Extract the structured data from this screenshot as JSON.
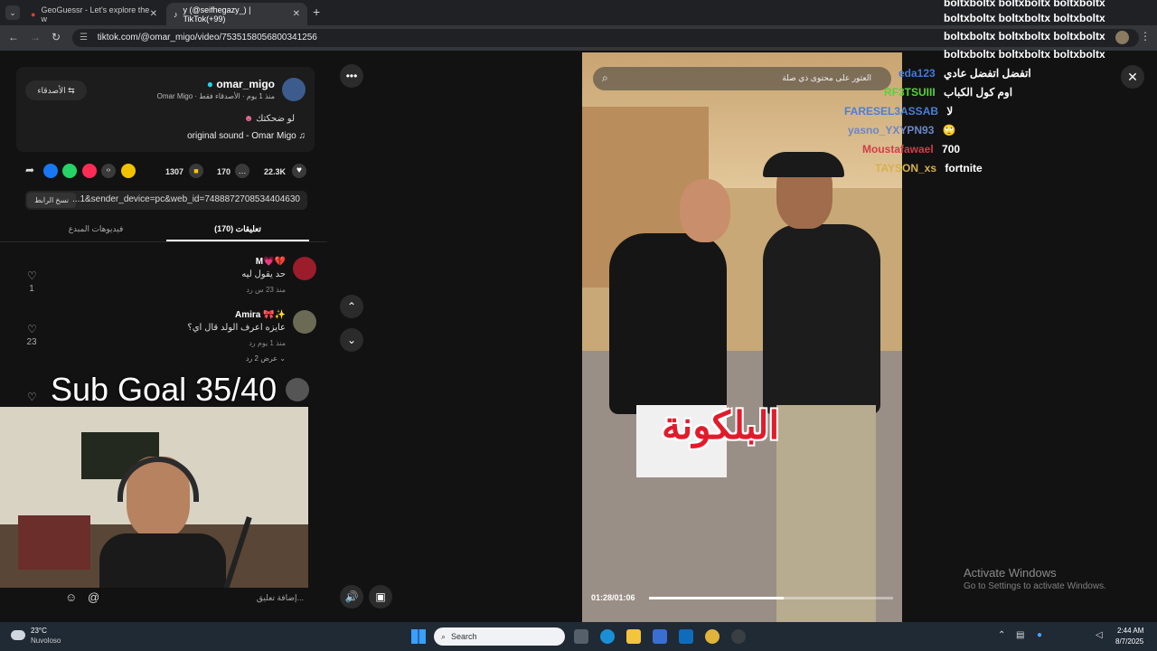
{
  "browser": {
    "tabs": [
      {
        "title": "GeoGuessr - Let's explore the w",
        "active": false
      },
      {
        "title": "y (@seifhegazy_) | TikTok(+99)",
        "active": true
      }
    ],
    "url": "tiktok.com/@omar_migo/video/7535158056800341256"
  },
  "post": {
    "username": "omar_migo",
    "meta": "Omar Migo · منذ 1 يوم · الأصدقاء فقط",
    "friends_button": "الأصدقاء",
    "caption": "لو ضحكتك",
    "sound": "original sound - Omar Migo",
    "counts": {
      "bookmarks": "1307",
      "comments": "170",
      "likes": "22.3K"
    },
    "link_text": "...1&sender_device=pc&web_id=7488872708534404630",
    "copy_link": "نسخ الرابط"
  },
  "tabs": {
    "comments": "(170) تعليقات",
    "creator_videos": "فيديوهات المبدع"
  },
  "comments": [
    {
      "name": "M💗💔",
      "text": "حد يقول ليه",
      "meta": "منذ 23 س   رد",
      "likes": "1"
    },
    {
      "name": "Amira 🎀✨",
      "text": "عايزه اعرف الولد قال اي؟",
      "meta": "منذ 1 يوم   رد",
      "likes": "23",
      "replies": "عرض 2 رد"
    }
  ],
  "overlay": {
    "sub_goal": "Sub Goal 35/40"
  },
  "comment_input": {
    "placeholder": "إضافة تعليق..."
  },
  "video": {
    "search_placeholder": "العثور على محتوى ذي صلة",
    "caption": "البلكونة",
    "time": "01:28/01:06",
    "progress": 0.55
  },
  "chat": {
    "spam": [
      "boltxboltx boltxboltx boltxboltx",
      "boltxboltx boltxboltx boltxboltx",
      "boltxboltx boltxboltx boltxboltx",
      "boltxboltx boltxboltx boltxboltx"
    ],
    "messages": [
      {
        "user": "eda123",
        "color": "#3f7be0",
        "text": "اتفضل اتفضل عادي"
      },
      {
        "user": "RF3TSUIII",
        "color": "#5ad13d",
        "text": "اوم كول الكباب"
      },
      {
        "user": "FARESEL3ASSAB",
        "color": "#4a7fd6",
        "text": "لا"
      },
      {
        "user": "yasno_YXYPN93",
        "color": "#6b86c9",
        "text": "🙄"
      },
      {
        "user": "Moustafawael",
        "color": "#d23d4a",
        "text": "700"
      },
      {
        "user": "TAYSON_xs",
        "color": "#d6b24a",
        "text": "fortnite"
      }
    ]
  },
  "watermark": {
    "title": "Activate Windows",
    "subtitle": "Go to Settings to activate Windows."
  },
  "taskbar": {
    "weather_temp": "23°C",
    "weather_desc": "Nuvoloso",
    "search": "Search",
    "time": "2:44 AM",
    "date": "8/7/2025"
  }
}
